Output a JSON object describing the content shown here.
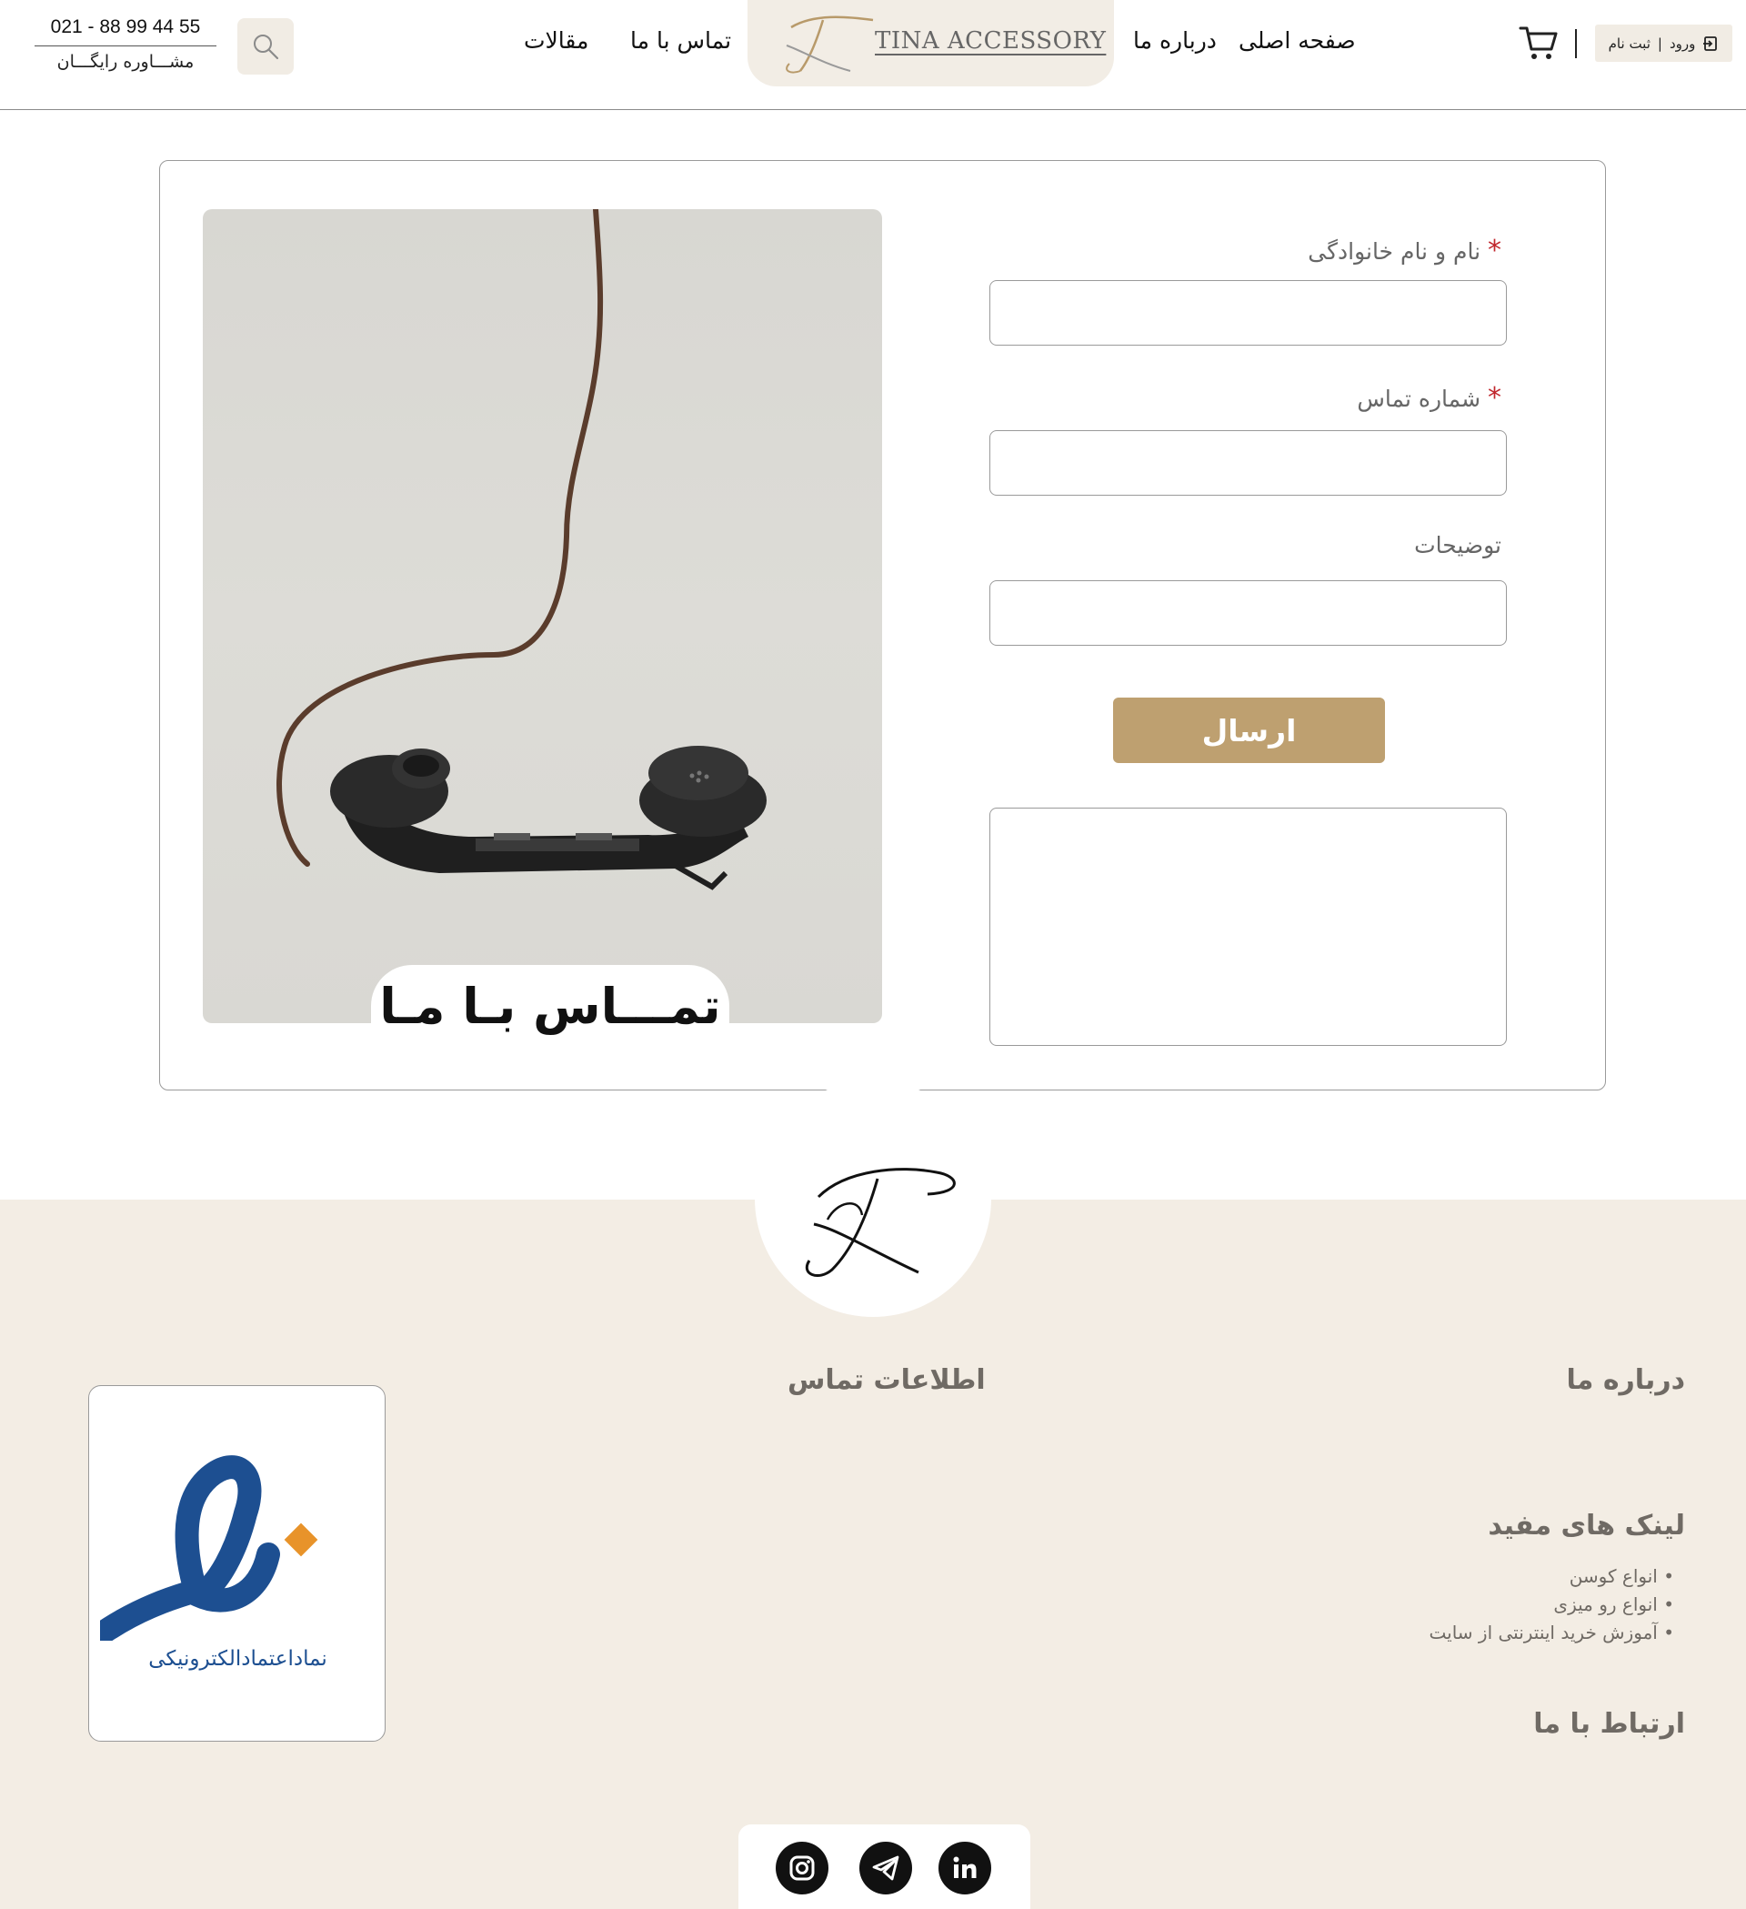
{
  "header": {
    "phone_number": "021 - 88 99 44 55",
    "phone_caption": "مشـــاوره رایگـــان",
    "nav": {
      "articles": "مقالات",
      "contact": "تماس با ما",
      "about": "درباره ما",
      "home": "صفحه اصلی"
    },
    "logo_text": "TINA ACCESSORY",
    "auth": {
      "register": "ثبت نام",
      "separator": "|",
      "login": "ورود"
    }
  },
  "contact_form": {
    "image_caption": "تمـــاس بـا مـا",
    "name_label": "نام و نام خانوادگی",
    "phone_label": "شماره تماس",
    "description_label": "توضیحات",
    "required_mark": "*",
    "name_value": "",
    "phone_value": "",
    "description_value": "",
    "submit_label": "ارسال",
    "message_value": ""
  },
  "footer": {
    "about_heading": "درباره ما",
    "contact_info_heading": "اطلاعات تماس",
    "links_heading": "لینک های مفید",
    "useful_links": [
      "انواع کوسن",
      "انواع رو میزی",
      "آموزش خرید اینترنتی از سایت"
    ],
    "connect_heading": "ارتباط با ما",
    "enamad_text": "نماداعتمادالکترونیکی",
    "social": [
      "instagram-icon",
      "telegram-icon",
      "linkedin-icon"
    ]
  },
  "colors": {
    "accent_gold": "#bea070",
    "beige": "#f3ede4",
    "required_red": "#c1272d",
    "enamad_blue": "#1d4f91",
    "enamad_orange": "#e8932a"
  }
}
